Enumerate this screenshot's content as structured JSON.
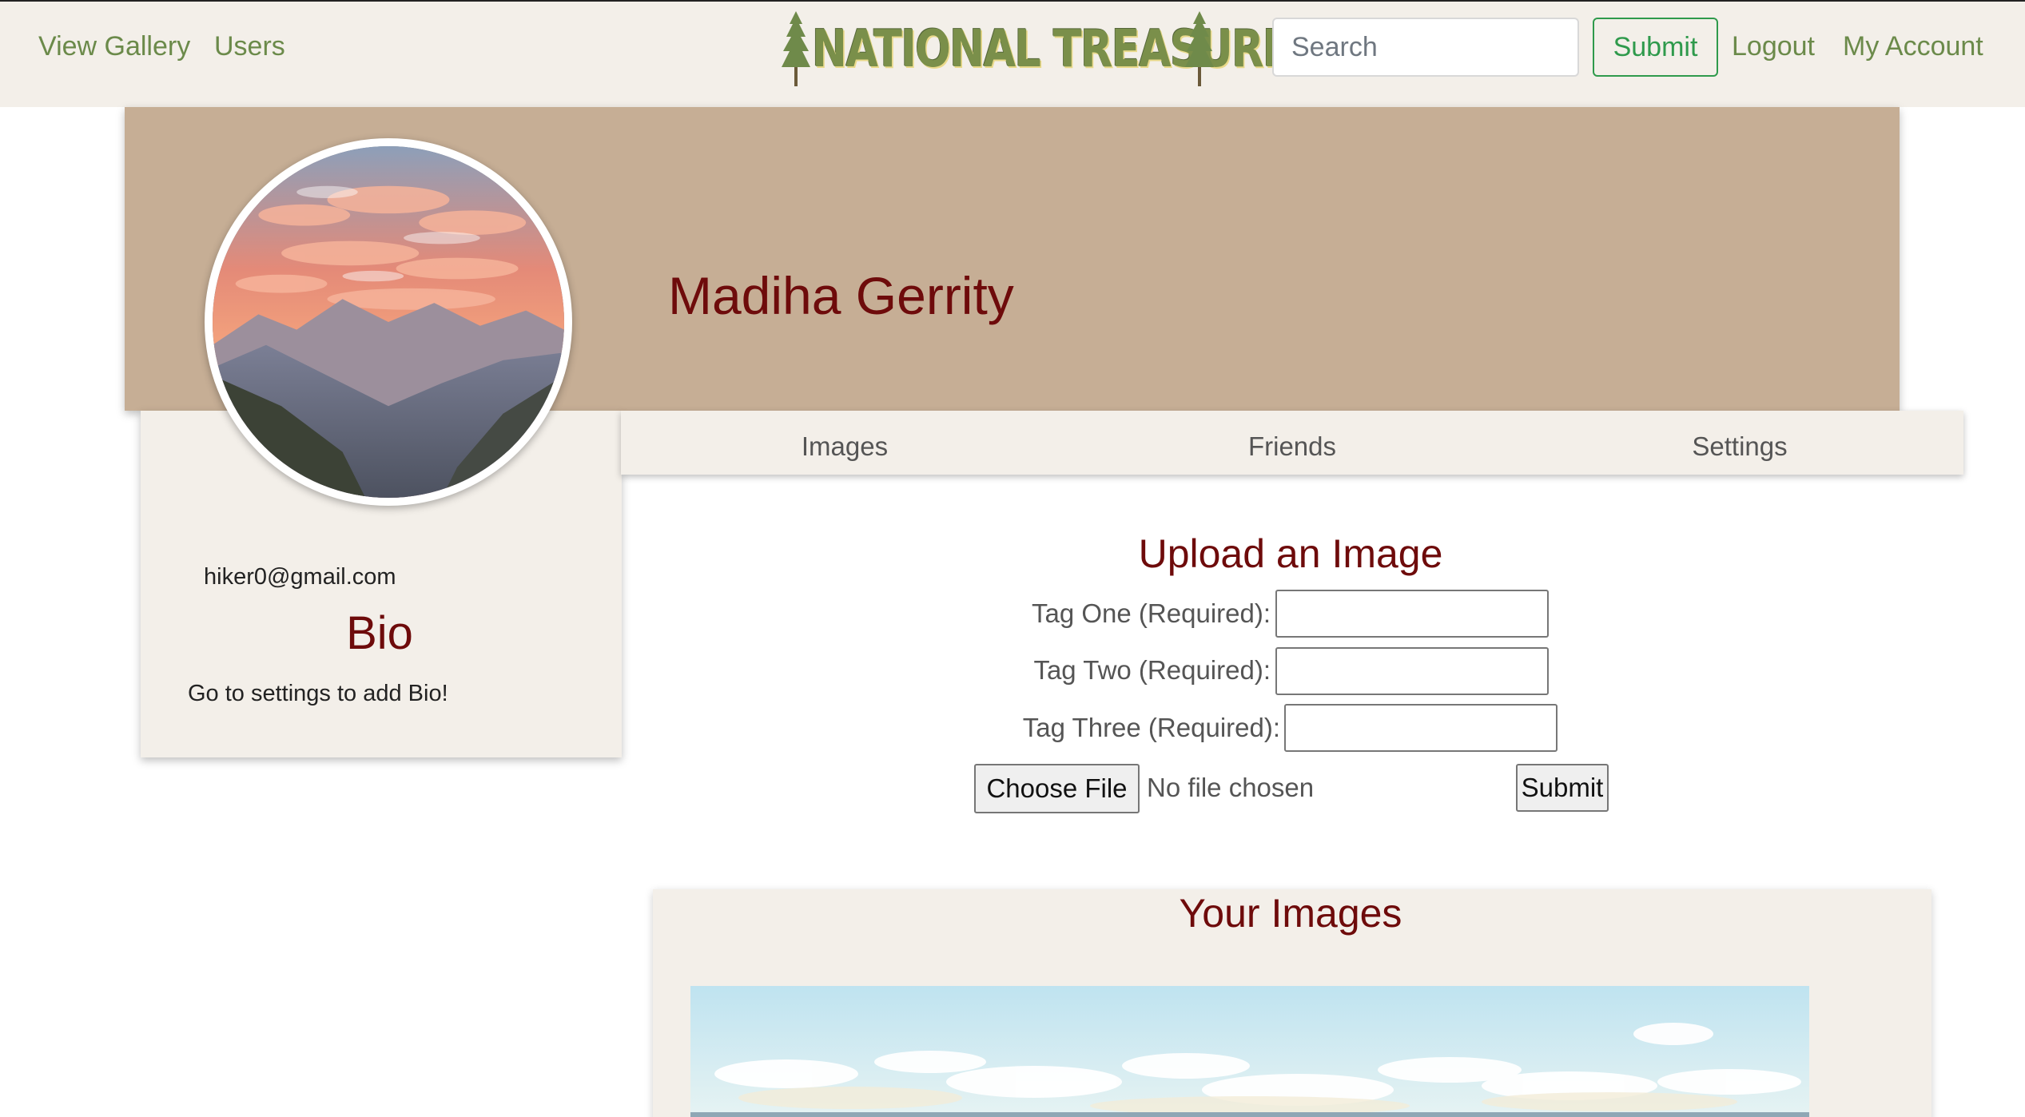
{
  "navbar": {
    "links": {
      "view_gallery": "View Gallery",
      "users": "Users",
      "logout": "Logout",
      "my_account": "My Account"
    },
    "brand": "NATIONAL TREASURES",
    "search": {
      "placeholder": "Search",
      "value": ""
    },
    "submit_label": "Submit"
  },
  "profile": {
    "name": "Madiha Gerrity",
    "email": "hiker0@gmail.com",
    "bio_title": "Bio",
    "bio_text": "Go to settings to add Bio!",
    "avatar_alt": "mountain-sunset-photo"
  },
  "tabs": [
    "Images",
    "Friends",
    "Settings"
  ],
  "upload_form": {
    "title": "Upload an Image",
    "fields": [
      {
        "label": "Tag One (Required):",
        "value": ""
      },
      {
        "label": "Tag Two (Required):",
        "value": ""
      },
      {
        "label": "Tag Three (Required):",
        "value": ""
      }
    ],
    "choose_file_label": "Choose File",
    "file_status": "No file chosen",
    "submit_label": "Submit"
  },
  "gallery": {
    "title": "Your Images"
  },
  "colors": {
    "navbar_bg": "#f3efe9",
    "nav_link": "#6b8a4a",
    "banner_bg": "#c6ae95",
    "heading": "#6e0b0b",
    "card_bg": "#f3efe9",
    "accent_green": "#2f9a4c"
  }
}
